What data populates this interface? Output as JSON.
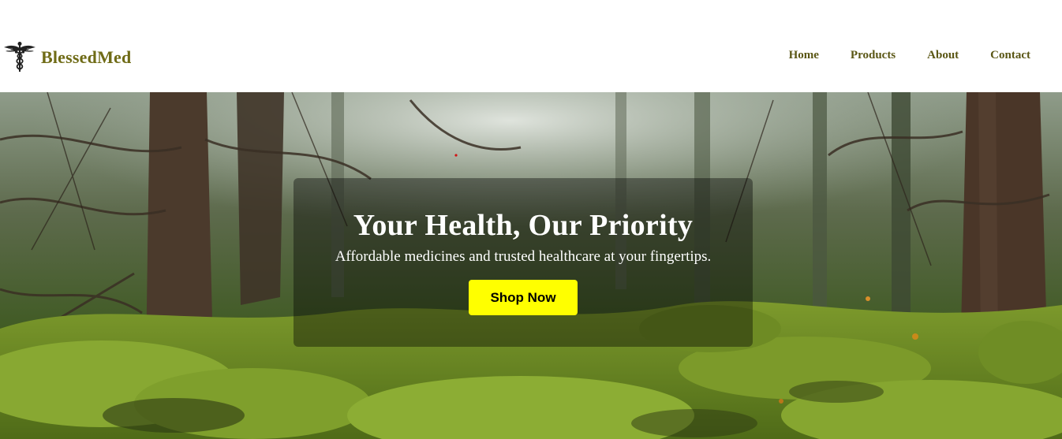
{
  "header": {
    "brand": {
      "name": "BlessedMed",
      "logo_icon": "caduceus-icon"
    },
    "nav": {
      "items": [
        {
          "label": "Home"
        },
        {
          "label": "Products"
        },
        {
          "label": "About"
        },
        {
          "label": "Contact"
        }
      ]
    }
  },
  "hero": {
    "background": "misty-mossy-forest-photo",
    "title": "Your Health, Our Priority",
    "subtitle": "Affordable medicines and trusted healthcare at your fingertips.",
    "cta_label": "Shop Now"
  },
  "colors": {
    "brand_text": "#6f6b16",
    "nav_text": "#5a5614",
    "cta_background": "#ffff00",
    "cta_text": "#000000",
    "overlay": "rgba(0,0,0,0.38)"
  }
}
